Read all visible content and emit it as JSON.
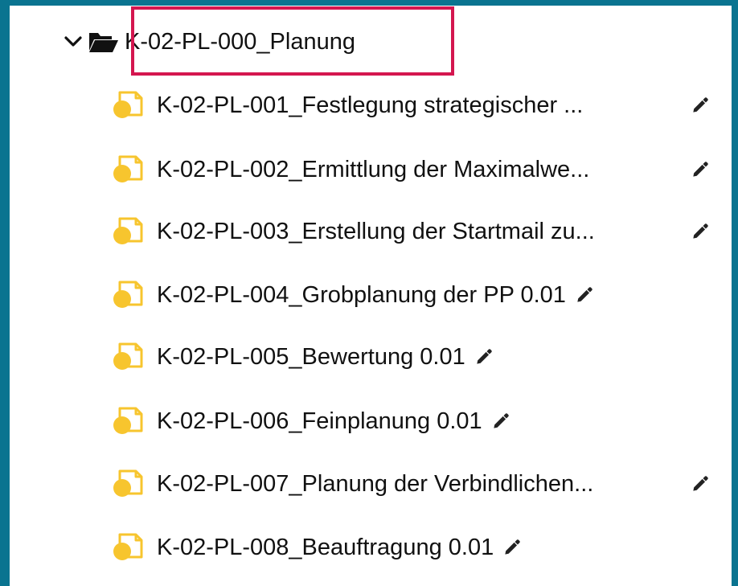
{
  "folder": {
    "title": "K-02-PL-000_Planung",
    "expanded": true,
    "icon": "folder-open-icon"
  },
  "items": [
    {
      "label": "K-02-PL-001_Festlegung strategischer ...",
      "icon": "document-icon",
      "edit_icon": "pencil-icon"
    },
    {
      "label": "K-02-PL-002_Ermittlung der Maximalwe...",
      "icon": "document-icon",
      "edit_icon": "pencil-icon"
    },
    {
      "label": "K-02-PL-003_Erstellung der Startmail zu...",
      "icon": "document-icon",
      "edit_icon": "pencil-icon"
    },
    {
      "label": "K-02-PL-004_Grobplanung der PP 0.01",
      "icon": "document-icon",
      "edit_icon": "pencil-icon"
    },
    {
      "label": "K-02-PL-005_Bewertung 0.01",
      "icon": "document-icon",
      "edit_icon": "pencil-icon"
    },
    {
      "label": "K-02-PL-006_Feinplanung 0.01",
      "icon": "document-icon",
      "edit_icon": "pencil-icon"
    },
    {
      "label": "K-02-PL-007_Planung der Verbindlichen...",
      "icon": "document-icon",
      "edit_icon": "pencil-icon"
    },
    {
      "label": "K-02-PL-008_Beauftragung 0.01",
      "icon": "document-icon",
      "edit_icon": "pencil-icon"
    }
  ],
  "colors": {
    "background": "#0a7490",
    "panel": "#ffffff",
    "highlight_border": "#d4164f",
    "doc_icon": "#f7c52e",
    "text": "#111111"
  }
}
